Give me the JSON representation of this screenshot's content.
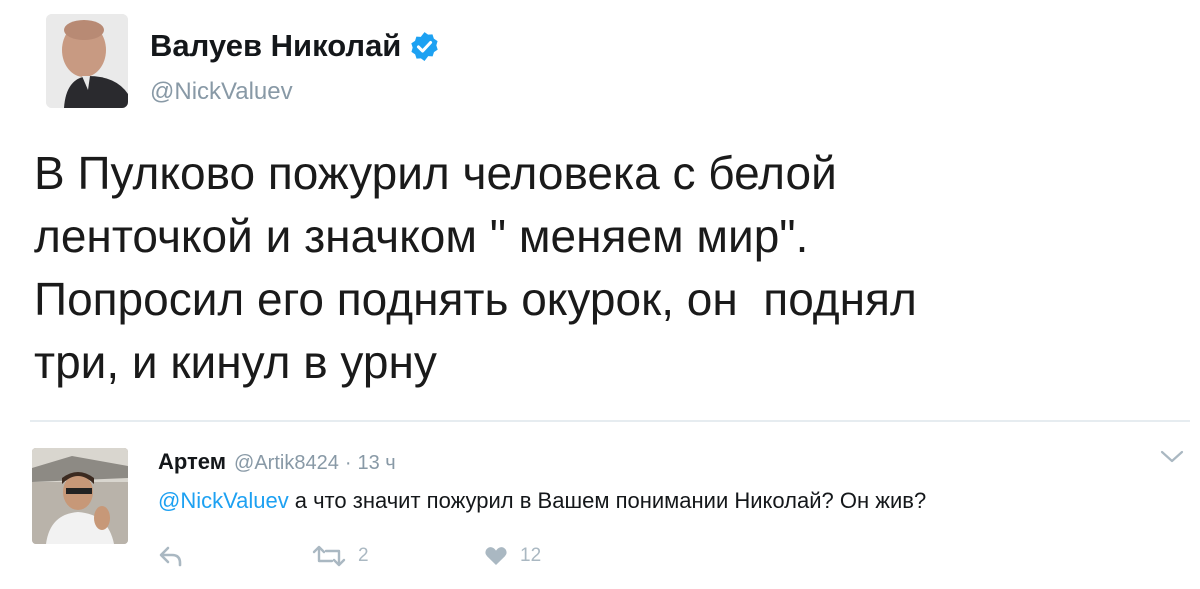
{
  "tweet": {
    "author_name": "Валуев Николай",
    "handle": "@NickValuev",
    "text": "В Пулково пожурил человека с белой\nленточкой и значком \" меняем мир\".\nПопросил его поднять окурок, он  поднял\nтри, и кинул в урну",
    "verified_icon": "verified-badge-icon"
  },
  "reply": {
    "name": "Артем",
    "handle": "@Artik8424",
    "separator": "·",
    "time": "13 ч",
    "mention": "@NickValuev",
    "text": "а что значит пожурил в Вашем понимании Николай? Он жив?",
    "retweet_count": "2",
    "like_count": "12"
  },
  "icons": {
    "reply": "reply-arrow-icon",
    "retweet": "retweet-icon",
    "like": "heart-icon",
    "caret": "chevron-down-icon"
  },
  "colors": {
    "verified": "#1da1f2",
    "link": "#1da1f2",
    "muted": "#8899a6",
    "action": "#aab8c2"
  }
}
